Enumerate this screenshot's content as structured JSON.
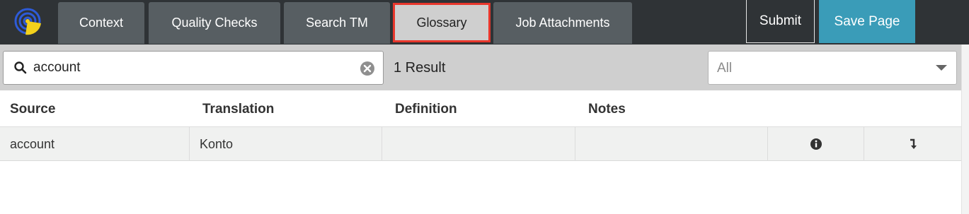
{
  "toolbar": {
    "logo_icon": "logo-icon",
    "tabs": [
      {
        "label": "Context"
      },
      {
        "label": "Quality Checks"
      },
      {
        "label": "Search TM"
      },
      {
        "label": "Glossary",
        "active": true
      },
      {
        "label": "Job Attachments"
      }
    ],
    "submit_label": "Submit",
    "save_label": "Save Page"
  },
  "search": {
    "value": "account",
    "icon": "search-icon",
    "clear_icon": "clear-icon",
    "result_count": "1 Result",
    "filter_value": "All"
  },
  "table": {
    "columns": [
      "Source",
      "Translation",
      "Definition",
      "Notes"
    ],
    "rows": [
      {
        "source": "account",
        "translation": "Konto",
        "definition": "",
        "notes": "",
        "info_icon": "info-icon",
        "insert_icon": "insert-arrow-icon"
      }
    ]
  },
  "colors": {
    "topbar": "#2f3336",
    "tab": "#575e62",
    "active_tab_border": "#e8372c",
    "save_button": "#3a9cb8"
  }
}
